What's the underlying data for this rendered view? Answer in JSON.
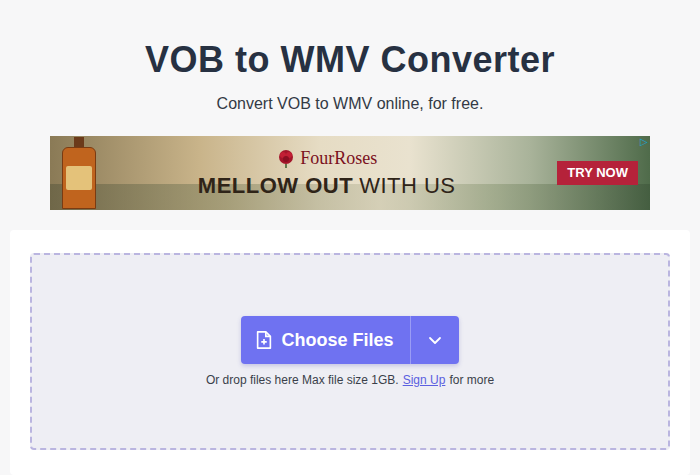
{
  "header": {
    "title": "VOB to WMV Converter",
    "subtitle": "Convert VOB to WMV online, for free."
  },
  "ad": {
    "brand": "FourRoses",
    "headline_bold": "MELLOW OUT",
    "headline_rest": "WITH US",
    "button": "TRY NOW",
    "adchoices": "▷"
  },
  "upload": {
    "button": "Choose Files",
    "hint": "Or drop files here Max file size 1GB.",
    "link": "Sign Up",
    "hint_end": "for more"
  }
}
